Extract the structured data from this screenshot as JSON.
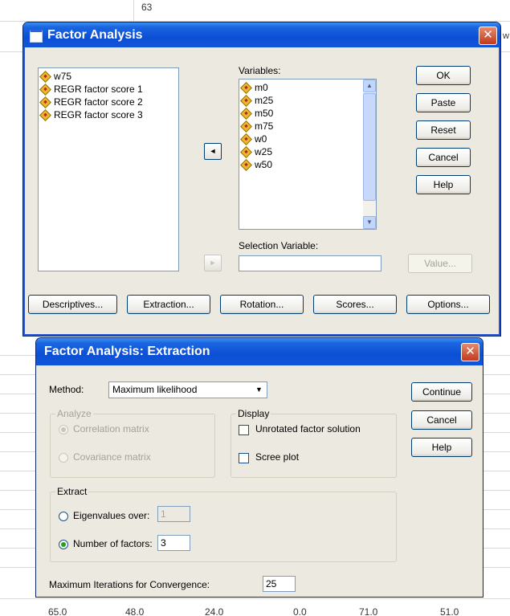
{
  "background": {
    "top_cell": "63",
    "right_edge_text": "w",
    "bottom_values": [
      "65.0",
      "48.0",
      "24.0",
      "0.0",
      "71.0",
      "51.0"
    ]
  },
  "factor_dialog": {
    "title": "Factor Analysis",
    "close_glyph": "✕",
    "source_list": [
      "w75",
      "REGR factor score  1",
      "REGR factor score  2",
      "REGR factor score  3"
    ],
    "variables_label": "Variables:",
    "variables": [
      "m0",
      "m25",
      "m50",
      "m75",
      "w0",
      "w25",
      "w50"
    ],
    "move_arrow": "◄",
    "selection_arrow": "►",
    "selection_label": "Selection Variable:",
    "selection_value": "",
    "buttons": {
      "ok": "OK",
      "paste": "Paste",
      "reset": "Reset",
      "cancel": "Cancel",
      "help": "Help",
      "value": "Value..."
    },
    "bottom_buttons": {
      "descriptives": "Descriptives...",
      "extraction": "Extraction...",
      "rotation": "Rotation...",
      "scores": "Scores...",
      "options": "Options..."
    },
    "scroll_up": "▲",
    "scroll_down": "▼"
  },
  "extraction_dialog": {
    "title": "Factor Analysis: Extraction",
    "close_glyph": "✕",
    "method_label": "Method:",
    "method_value": "Maximum likelihood",
    "dropdown_glyph": "▼",
    "analyze_caption": "Analyze",
    "correlation_label": "Correlation matrix",
    "covariance_label": "Covariance matrix",
    "display_caption": "Display",
    "unrotated_label": "Unrotated factor solution",
    "scree_label": "Scree plot",
    "extract_caption": "Extract",
    "eigen_label": "Eigenvalues over:",
    "eigen_value": "1",
    "nfactors_label": "Number of factors:",
    "nfactors_value": "3",
    "maxiter_label": "Maximum Iterations for Convergence:",
    "maxiter_value": "25",
    "buttons": {
      "continue": "Continue",
      "cancel": "Cancel",
      "help": "Help"
    }
  }
}
